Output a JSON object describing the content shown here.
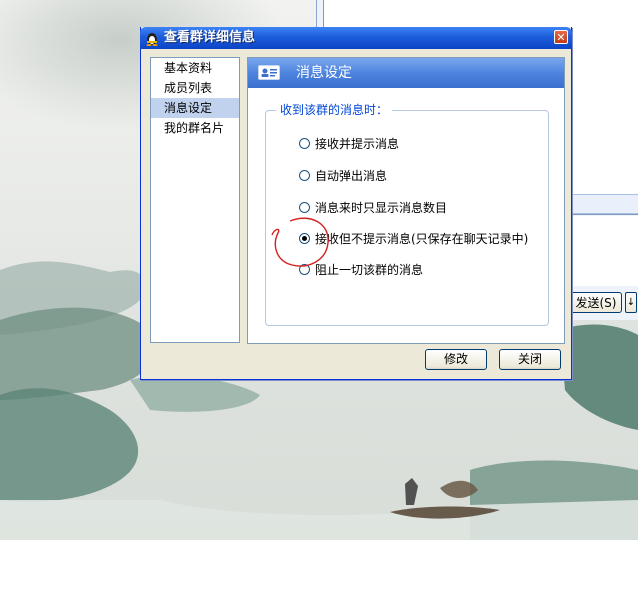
{
  "dialog": {
    "title": "查看群详细信息",
    "close_glyph": "✕"
  },
  "sidebar": {
    "items": [
      {
        "label": "基本资料",
        "selected": false
      },
      {
        "label": "成员列表",
        "selected": false
      },
      {
        "label": "消息设定",
        "selected": true
      },
      {
        "label": "我的群名片",
        "selected": false
      }
    ]
  },
  "panel": {
    "title": "消息设定",
    "group_label": "收到该群的消息时：",
    "options": [
      {
        "label": "接收并提示消息",
        "checked": false
      },
      {
        "label": "自动弹出消息",
        "checked": false
      },
      {
        "label": "消息来时只显示消息数目",
        "checked": false
      },
      {
        "label": "接收但不提示消息(只保存在聊天记录中)",
        "checked": true
      },
      {
        "label": "阻止一切该群的消息",
        "checked": false
      }
    ]
  },
  "buttons": {
    "modify": "修改",
    "close": "关闭"
  },
  "background_window": {
    "send_label": "发送(S)",
    "send_arrow": "↓"
  },
  "colors": {
    "titlebar": "#0b44c7",
    "panel_header": "#4d84df",
    "annotation_circle": "#d42020"
  }
}
